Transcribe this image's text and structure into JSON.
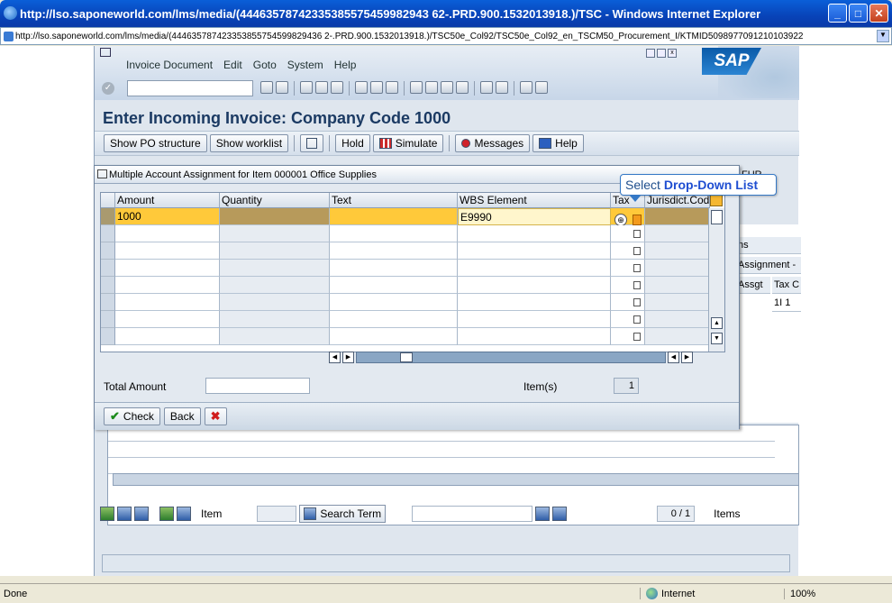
{
  "browser": {
    "title": "http://lso.saponeworld.com/lms/media/(44463578742335385575459982943 62-.PRD.900.1532013918.)/TSC - Windows Internet Explorer",
    "address": "http://lso.saponeworld.com/lms/media/(444635787423353855754599829436 2-.PRD.900.1532013918.)/TSC50e_Col92/TSC50e_Col92_en_TSCM50_Procurement_I/KTMID5098977091210103922",
    "status_text": "Done",
    "zone": "Internet",
    "zoom": "100%"
  },
  "menu": [
    "Invoice Document",
    "Edit",
    "Goto",
    "System",
    "Help"
  ],
  "sap_logo": "SAP",
  "page_title": "Enter Incoming Invoice: Company Code 1000",
  "app_toolbar": {
    "show_po": "Show PO structure",
    "show_worklist": "Show worklist",
    "hold": "Hold",
    "simulate": "Simulate",
    "messages": "Messages",
    "help": "Help"
  },
  "background": {
    "fur": "FUR",
    "right_cells": [
      "ns",
      "Assignment -",
      "Assgt",
      "Tax C",
      "1I 1"
    ],
    "item_label": "Item",
    "search_term": "Search Term",
    "page_count": "0 / 1",
    "items_label": "Items"
  },
  "popup": {
    "title": "Multiple Account Assignment for Item 000001 Office Supplies",
    "columns": [
      "Amount",
      "Quantity",
      "Text",
      "WBS Element",
      "Tax",
      "Jurisdict.Code"
    ],
    "row1": {
      "amount": "1000",
      "wbs": "E9990"
    },
    "total_amount_label": "Total Amount",
    "items_label": "Item(s)",
    "items_count": "1",
    "check": "Check",
    "back": "Back"
  },
  "tooltip": {
    "prefix": "Select",
    "target": "Drop-Down List"
  },
  "colors": {
    "selected_row": "#ffc93a",
    "title_blue": "#1b3a63",
    "tooltip_border": "#3478c6"
  }
}
